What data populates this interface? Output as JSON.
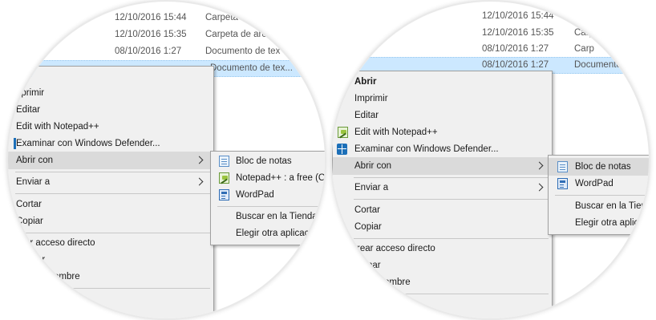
{
  "files": [
    {
      "date": "12/10/2016 15:44",
      "type": "Carpeta"
    },
    {
      "date": "12/10/2016 15:35",
      "type": "Carpeta de arc"
    },
    {
      "date": "08/10/2016 1:27",
      "type": "Documento de tex"
    },
    {
      "date": "",
      "type": "Documento de tex..."
    }
  ],
  "files_right": [
    {
      "date": "12/10/2016 15:44",
      "type": ""
    },
    {
      "date": "12/10/2016 15:35",
      "type": "Carp"
    },
    {
      "date": "08/10/2016 1:27",
      "type": "Carp"
    },
    {
      "date": "08/10/2016 1:27",
      "type": "Documento"
    }
  ],
  "left_menu": {
    "items": {
      "open": "rir",
      "print": "nprimir",
      "edit": "Editar",
      "edit_npp": "Edit with Notepad++",
      "defender": "Examinar con Windows Defender...",
      "open_with": "Abrir con",
      "send_to": "Enviar a",
      "cut": "Cortar",
      "copy": "Copiar",
      "shortcut": "ar acceso directo",
      "delete": "ar",
      "rename": "ombre"
    },
    "submenu": {
      "notepad": "Bloc de notas",
      "npp": "Notepad++ : a free (C",
      "wordpad": "WordPad",
      "store": "Buscar en la Tienda",
      "other": "Elegir otra aplicac"
    }
  },
  "right_menu": {
    "items": {
      "open": "Abrir",
      "print": "Imprimir",
      "edit": "Editar",
      "edit_npp": "Edit with Notepad++",
      "defender": "Examinar con Windows Defender...",
      "open_with": "Abrir con",
      "send_to": "Enviar a",
      "cut": "Cortar",
      "copy": "Copiar",
      "shortcut": "rear acceso directo",
      "delete": "nar",
      "rename": "ombre"
    },
    "submenu": {
      "notepad": "Bloc de notas",
      "wordpad": "WordPad",
      "store": "Buscar en la Tiend",
      "other": "Elegir otra aplic"
    }
  },
  "icons": {
    "notepad": "notepad-icon",
    "notepadpp": "notepadpp-icon",
    "wordpad": "wordpad-icon",
    "defender": "windows-defender-icon",
    "chevron": "chevron-right-icon"
  },
  "colors": {
    "selection": "#cce8ff",
    "menu_bg": "#f0f0f0",
    "hover": "#dadada"
  }
}
